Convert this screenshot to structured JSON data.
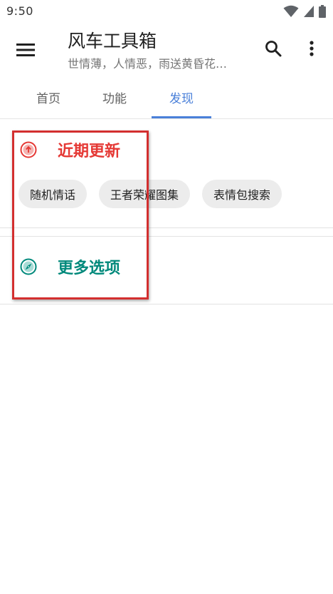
{
  "status_bar": {
    "time": "9:50",
    "icons": [
      "wifi-icon",
      "signal-icon",
      "battery-icon"
    ]
  },
  "app_bar": {
    "title": "风车工具箱",
    "subtitle": "世情薄，人情恶，雨送黄昏花…",
    "icons": [
      "menu-icon",
      "search-icon",
      "more-vert-icon"
    ]
  },
  "tabs": [
    {
      "label": "首页",
      "selected": false
    },
    {
      "label": "功能",
      "selected": false
    },
    {
      "label": "发现",
      "selected": true
    }
  ],
  "sections": {
    "recent": {
      "title": "近期更新",
      "icon": "arrow-up-circle-icon",
      "chips": [
        {
          "label": "随机情话"
        },
        {
          "label": "王者荣耀图集"
        },
        {
          "label": "表情包搜索"
        }
      ]
    },
    "more": {
      "title": "更多选项",
      "icon": "compass-icon"
    }
  },
  "colors": {
    "accent": "#4a80d9",
    "recent_title": "#e53935",
    "more_title": "#00897b",
    "chip_bg": "#ececec",
    "highlight_border": "#d32f2f"
  }
}
